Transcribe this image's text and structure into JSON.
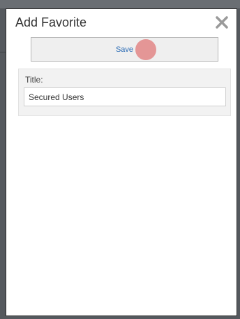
{
  "dialog": {
    "title": "Add Favorite",
    "save_label": "Save",
    "close_icon": "close-icon"
  },
  "form": {
    "title_label": "Title:",
    "title_value": "Secured Users"
  },
  "colors": {
    "save_text": "#2a6bb5",
    "click_marker": "#e07878"
  }
}
